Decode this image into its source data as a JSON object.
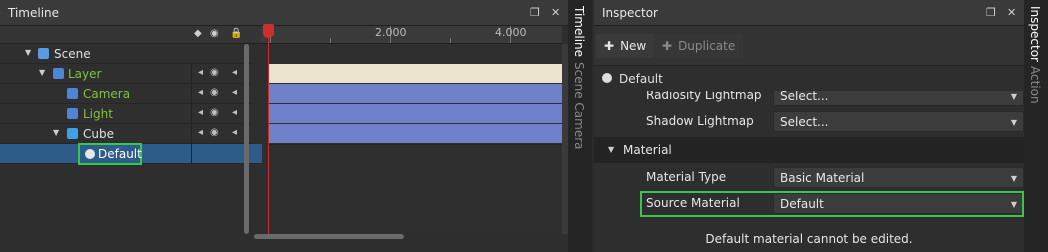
{
  "timeline": {
    "title": "Timeline",
    "icons": [
      "maximize-icon",
      "close-icon"
    ],
    "ruler_labels": [
      "2.000",
      "4.000"
    ],
    "tree": [
      {
        "label": "Scene",
        "icon": "scene-icon",
        "color": "#e0e0e0",
        "expanded": true
      },
      {
        "label": "Layer",
        "icon": "layer-icon",
        "color": "#7fc241",
        "expanded": true
      },
      {
        "label": "Camera",
        "icon": "camera-icon",
        "color": "#7fc241"
      },
      {
        "label": "Light",
        "icon": "light-icon",
        "color": "#7fc241"
      },
      {
        "label": "Cube",
        "icon": "cube-icon",
        "color": "#e0e0e0",
        "expanded": true
      },
      {
        "label": "Default",
        "icon": "material-icon",
        "color": "#ffffff",
        "selected": true
      }
    ]
  },
  "side_tabs_left": {
    "active": "Timeline",
    "inactive": "Scene Camera"
  },
  "side_tabs_right": {
    "active": "Inspector",
    "inactive": "Action"
  },
  "inspector": {
    "title": "Inspector",
    "new_label": "New",
    "duplicate_label": "Duplicate",
    "item_name": "Default",
    "rows_top": [
      {
        "label": "Radiosity Lightmap",
        "value": "Select..."
      },
      {
        "label": "Shadow Lightmap",
        "value": "Select..."
      }
    ],
    "section": "Material",
    "rows_material": [
      {
        "label": "Material Type",
        "value": "Basic Material"
      },
      {
        "label": "Source Material",
        "value": "Default"
      }
    ],
    "note": "Default material cannot be edited."
  },
  "colors": {
    "accent_green": "#39c74a",
    "track_blue": "#6f81c8",
    "track_cream": "#ece4cf",
    "playhead_red": "#c9302c",
    "selection_blue": "#2d5b8a"
  }
}
